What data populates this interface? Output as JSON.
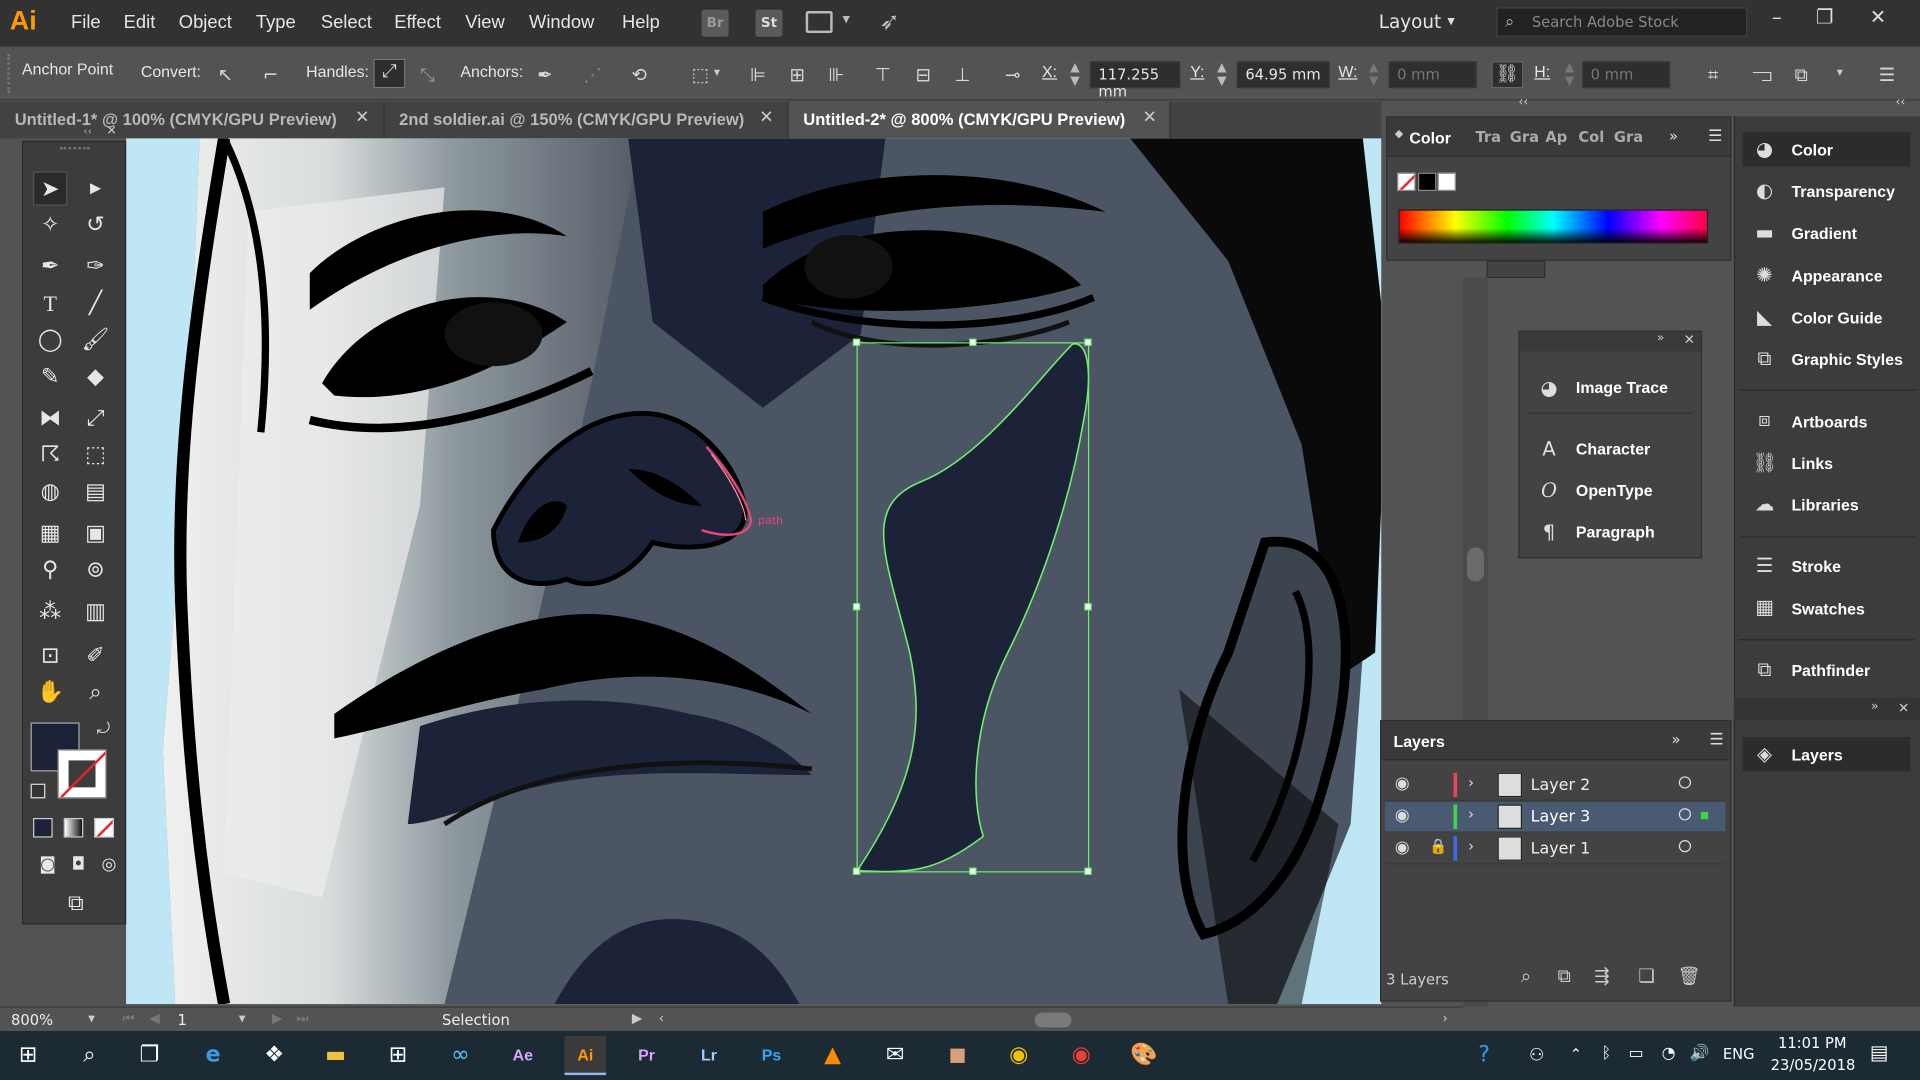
{
  "app": {
    "logo": "Ai"
  },
  "menu": [
    "File",
    "Edit",
    "Object",
    "Type",
    "Select",
    "Effect",
    "View",
    "Window",
    "Help"
  ],
  "menubar_tiles": {
    "br": "Br",
    "st": "St"
  },
  "workspace": {
    "label": "Layout"
  },
  "search": {
    "placeholder": "Search Adobe Stock"
  },
  "control": {
    "anchor_point": "Anchor Point",
    "convert": "Convert:",
    "handles": "Handles:",
    "anchors": "Anchors:",
    "x_label": "X:",
    "x_value": "117.255 mm",
    "y_label": "Y:",
    "y_value": "64.95 mm",
    "w_label": "W:",
    "w_value": "0 mm",
    "h_label": "H:",
    "h_value": "0 mm"
  },
  "tabs": [
    {
      "label": "Untitled-1* @ 100% (CMYK/GPU Preview)",
      "active": false
    },
    {
      "label": "2nd soldier.ai @ 150% (CMYK/GPU Preview)",
      "active": false
    },
    {
      "label": "Untitled-2* @ 800% (CMYK/GPU Preview)",
      "active": true
    }
  ],
  "canvas": {
    "path_label": "path",
    "fill": "#1c2238",
    "path_color": "#e8457a",
    "selection_color": "#6fef6f"
  },
  "color_panel": {
    "title": "Color",
    "tabs": [
      "Tra",
      "Gra",
      "Ap",
      "Col",
      "Gra"
    ]
  },
  "float_panel": [
    "Image Trace",
    "Character",
    "OpenType",
    "Paragraph"
  ],
  "dock": {
    "group1": [
      "Color",
      "Transparency",
      "Gradient",
      "Appearance",
      "Color Guide",
      "Graphic Styles"
    ],
    "group2": [
      "Artboards",
      "Links",
      "Libraries"
    ],
    "group3": [
      "Stroke",
      "Swatches"
    ],
    "group4": [
      "Pathfinder"
    ],
    "layers_label": "Layers"
  },
  "layers_panel": {
    "title": "Layers",
    "rows": [
      {
        "name": "Layer 2",
        "color": "#e8455a",
        "locked": false,
        "selected": false
      },
      {
        "name": "Layer 3",
        "color": "#3ed44a",
        "locked": false,
        "selected": true
      },
      {
        "name": "Layer 1",
        "color": "#3a6ce8",
        "locked": true,
        "selected": false
      }
    ],
    "count": "3 Layers"
  },
  "status": {
    "zoom": "800%",
    "artboard": "1",
    "tool": "Selection"
  },
  "taskbar": {
    "apps": [
      "Ae",
      "Ai",
      "Pr",
      "Lr",
      "Ps"
    ],
    "lang": "ENG",
    "time": "11:01 PM",
    "date": "23/05/2018"
  },
  "colors": {
    "fill_swatch": "#1c2238",
    "accent": "#ff9a00"
  }
}
